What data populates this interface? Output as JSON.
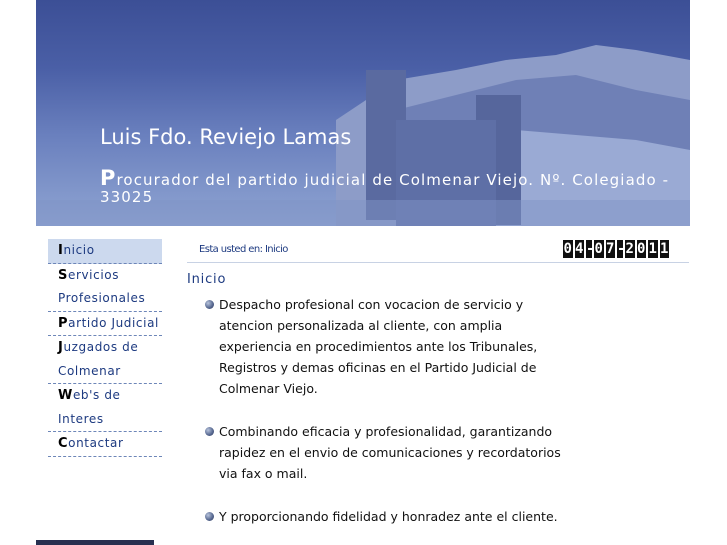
{
  "header": {
    "title": "Luis Fdo. Reviejo Lamas",
    "subtitle_first_letter": "P",
    "subtitle_rest": "rocurador del partido judicial de Colmenar Viejo. Nº. Colegiado - 33025"
  },
  "sidebar": {
    "items": [
      {
        "first": "I",
        "rest": "nicio",
        "active": true
      },
      {
        "first": "S",
        "rest": "ervicios Profesionales"
      },
      {
        "first": "P",
        "rest": "artido Judicial"
      },
      {
        "first": "J",
        "rest": "uzgados de Colmenar"
      },
      {
        "first": "W",
        "rest": "eb's de Interes"
      },
      {
        "first": "C",
        "rest": "ontactar"
      }
    ]
  },
  "breadcrumb": "Esta usted en: Inicio",
  "date": "04-07-2011",
  "main": {
    "section_title": "Inicio",
    "bullets": [
      "Despacho profesional con vocacion de servicio y atencion personalizada al cliente, con amplia experiencia en procedimientos ante los Tribunales, Registros y demas oficinas en el Partido Judicial de Colmenar Viejo.",
      "Combinando eficacia y profesionalidad, garantizando rapidez en el envio de comunicaciones y recordatorios via fax o mail.",
      "Y proporcionando fidelidad y honradez ante el cliente."
    ]
  }
}
